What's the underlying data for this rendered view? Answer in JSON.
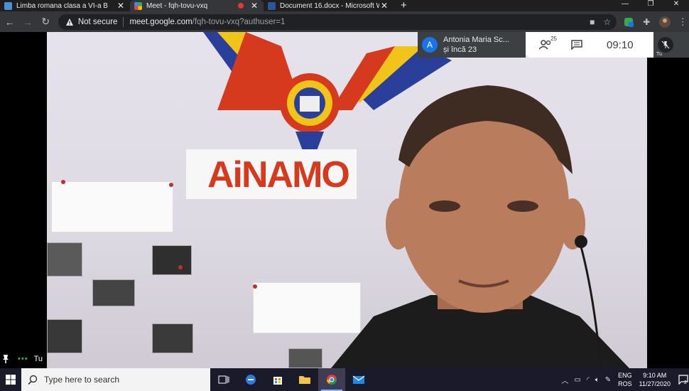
{
  "browser": {
    "tabs": [
      {
        "title": "Limba romana clasa a VI-a B",
        "active": false,
        "favicon_color": "#4a90d9"
      },
      {
        "title": "Meet - fqh-tovu-vxq",
        "active": true,
        "favicon_color": "#34a853",
        "recording": true
      },
      {
        "title": "Document 16.docx - Microsoft W",
        "active": false,
        "favicon_color": "#2b579a"
      }
    ],
    "new_tab_label": "+",
    "close_label": "✕",
    "security_label": "Not secure",
    "url_host": "meet.google.com",
    "url_path": "/fqh-tovu-vxq?authuser=1"
  },
  "meet": {
    "host_initial": "A",
    "host_name": "Antonia Maria Sc...",
    "host_others": "și încă 23",
    "participants_count": "25",
    "time": "09:10",
    "self_label": "Tu",
    "bottom_self_label": "Tu"
  },
  "wall": {
    "banner_text": "AiNAMO"
  },
  "taskbar": {
    "search_placeholder": "Type here to search",
    "lang_top": "ENG",
    "lang_bottom": "ROS",
    "time": "9:10 AM",
    "date": "11/27/2020",
    "notification_count": "2"
  },
  "colors": {
    "tab_bg": "#1f1f1f",
    "toolbar_bg": "#35363a",
    "taskbar_bg": "#1b1a2b",
    "meet_accent": "#1a73e8"
  }
}
